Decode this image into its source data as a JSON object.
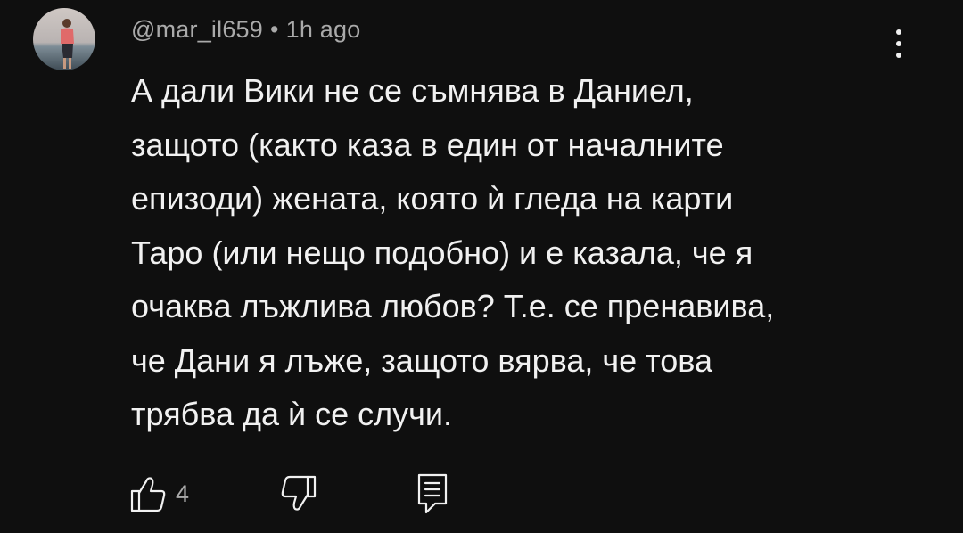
{
  "comment": {
    "author": "@mar_il659",
    "separator": "•",
    "time": "1h ago",
    "text_lines": [
      "А дали Вики не се съмнява в Даниел,",
      "защото (както каза в един от началните",
      "епизоди) жената, която ѝ гледа на карти",
      "Таро (или нещо подобно) и е казала, че я",
      "очаква лъжлива любов? Т.е. се пренавива,",
      "че Дани я лъже, защото вярва, че това",
      "трябва да ѝ се случи."
    ],
    "likes": "4"
  },
  "icons": {
    "more": "more-vertical-icon",
    "like": "thumbs-up-icon",
    "dislike": "thumbs-down-icon",
    "reply": "reply-comment-icon"
  },
  "colors": {
    "background": "#0f0f0f",
    "text": "#f1f1f1",
    "secondary_text": "#aaaaaa"
  }
}
